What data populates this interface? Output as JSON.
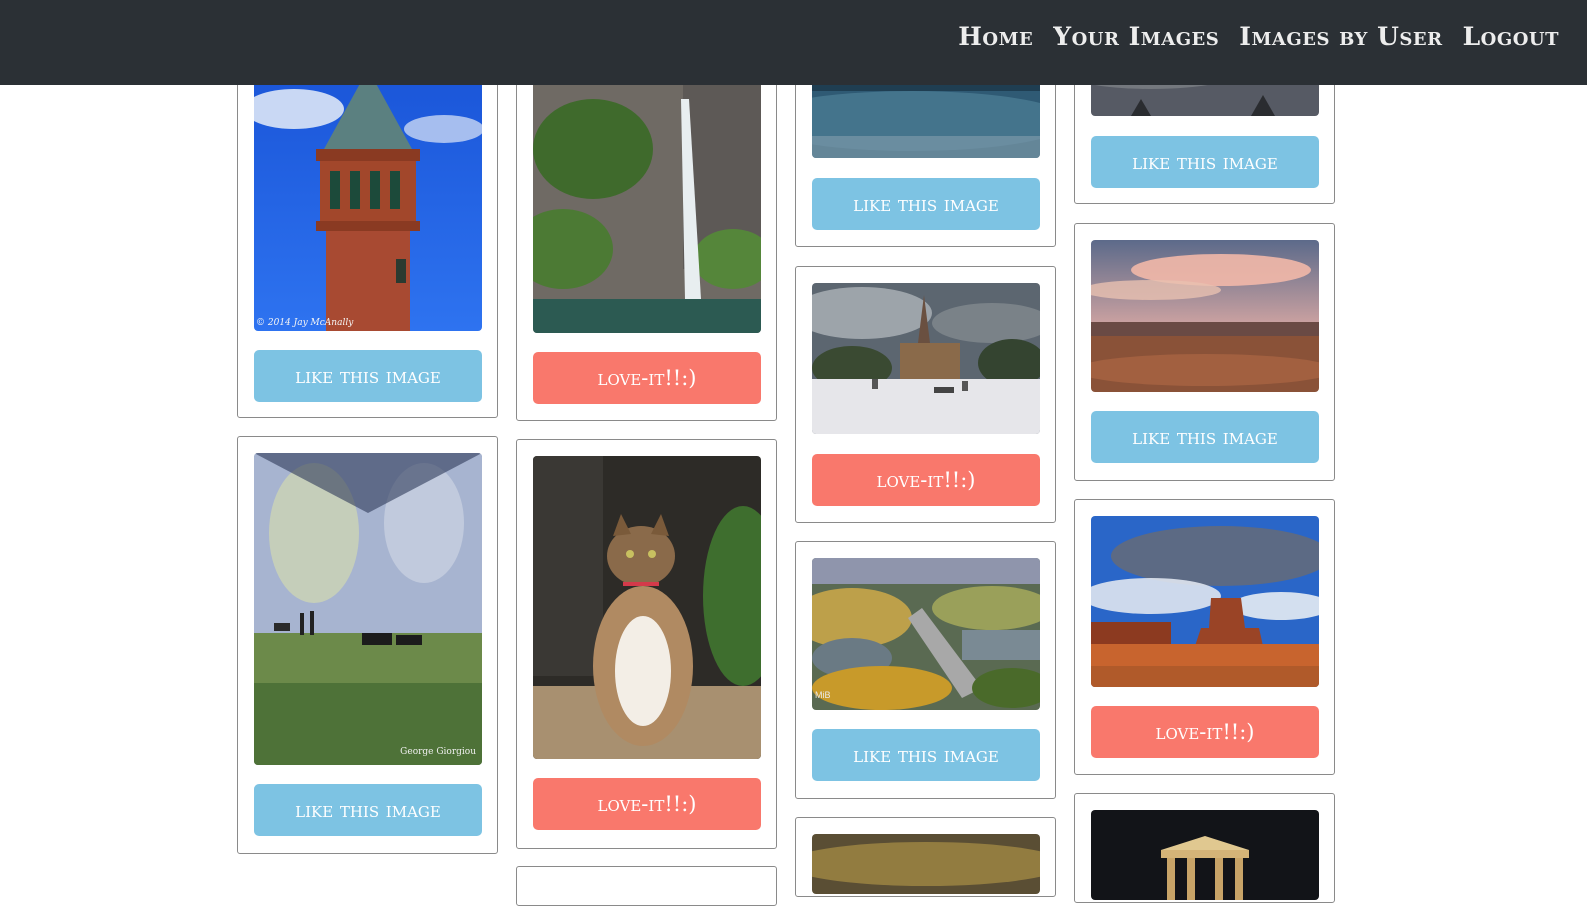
{
  "nav": {
    "links": [
      "Home",
      "Your Images",
      "Images by User",
      "Logout"
    ]
  },
  "buttons": {
    "like": "like this image",
    "love": "love-it!!:)"
  },
  "watermarks": {
    "tower": "© 2014 Jay McAnally",
    "museum": "George Giorgiou",
    "dam": "MiB"
  },
  "colors": {
    "navbar": "#2b3035",
    "like_button": "#7dc3e3",
    "love_button": "#f9786c"
  }
}
